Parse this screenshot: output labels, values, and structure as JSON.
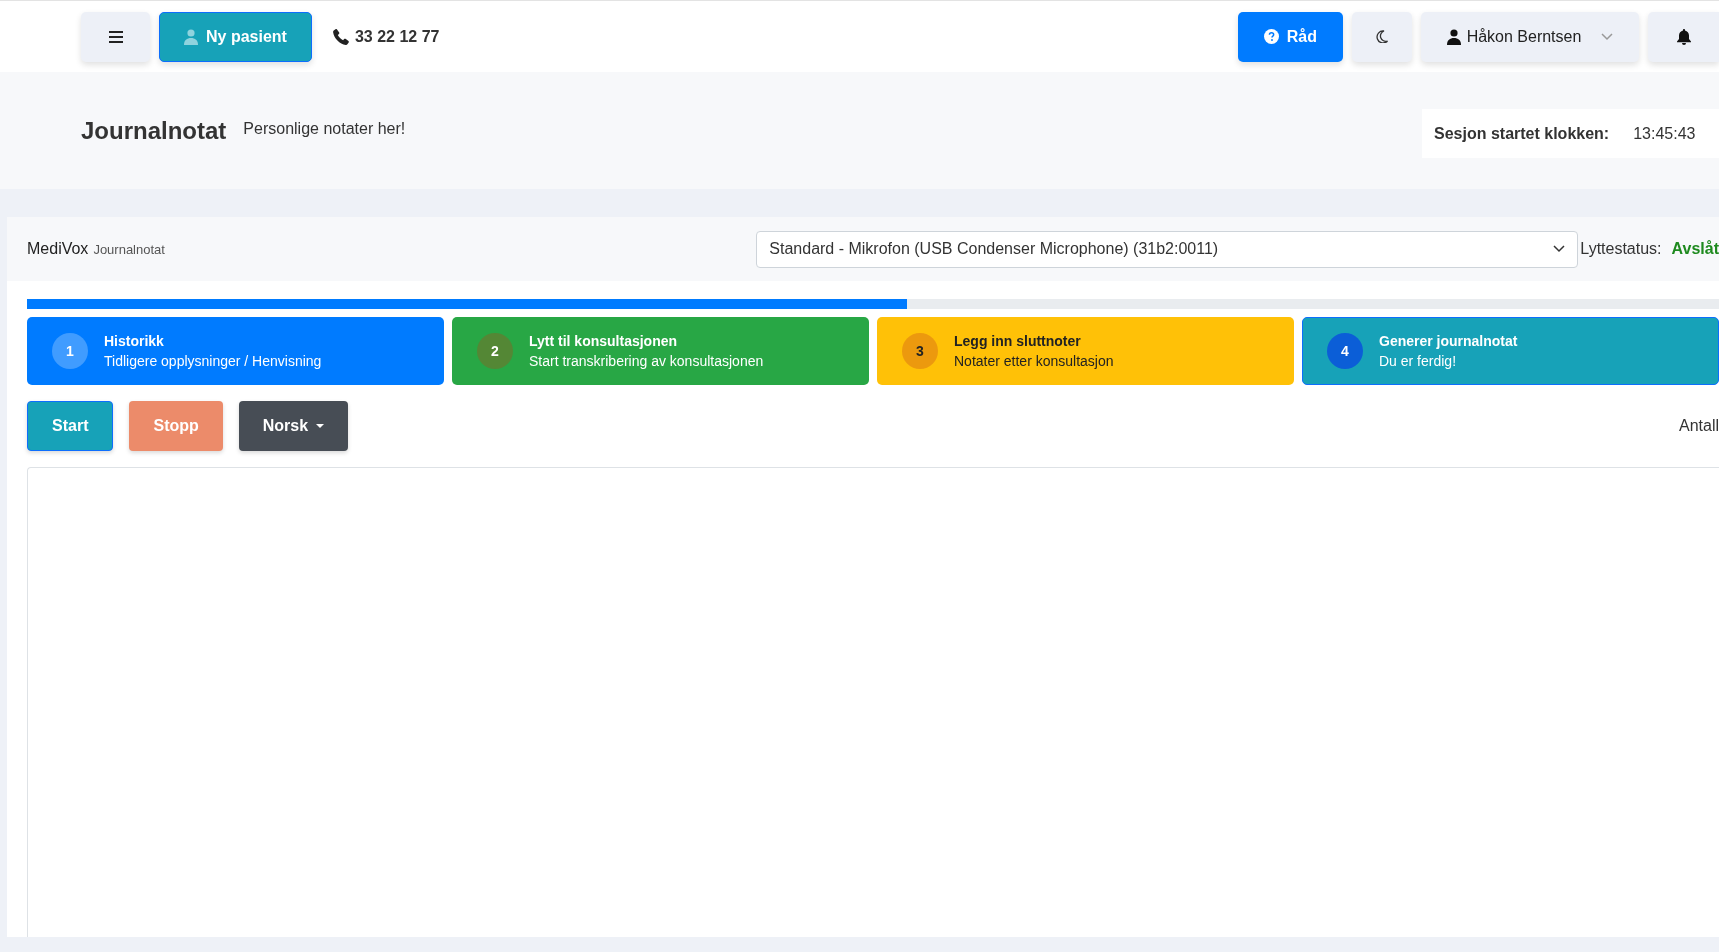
{
  "topbar": {
    "new_patient_button": "Ny pasient",
    "phone": "33 22 12 77",
    "advice_button": "Råd",
    "user_menu": "Håkon Berntsen"
  },
  "page_header": {
    "title": "Journalnotat",
    "subtitle": "Personlige notater her!",
    "session_label": "Sesjon startet klokken:",
    "session_time": "13:45:43"
  },
  "card": {
    "brand": "MediVox",
    "brand_sub": "Journalnotat",
    "microphone_select": "Standard - Mikrofon (USB Condenser Microphone) (31b2:0011)",
    "status_label": "Lyttestatus:",
    "status_value": "Avslåt",
    "progress": {
      "level": 0.52
    },
    "steps": [
      {
        "number": "1",
        "title": "Historikk",
        "subtitle": "Tidligere opplysninger / Henvisning",
        "color": "#007bff",
        "selected": false
      },
      {
        "number": "2",
        "title": "Lytt til konsultasjonen",
        "subtitle": "Start transkribering av konsultasjonen",
        "color": "#28a745",
        "selected": false
      },
      {
        "number": "3",
        "title": "Legg inn sluttnoter",
        "subtitle": "Notater etter konsultasjon",
        "color": "#ffc107",
        "selected": false
      },
      {
        "number": "4",
        "title": "Generer journalnotat",
        "subtitle": "Du er ferdig!",
        "color": "#17a2b8",
        "selected": true
      }
    ],
    "buttons": [
      {
        "label": "Start",
        "kind": "start"
      },
      {
        "label": "Stopp",
        "kind": "stop"
      },
      {
        "label": "Norsk",
        "kind": "dropdown"
      }
    ],
    "count_label": "Antall"
  }
}
